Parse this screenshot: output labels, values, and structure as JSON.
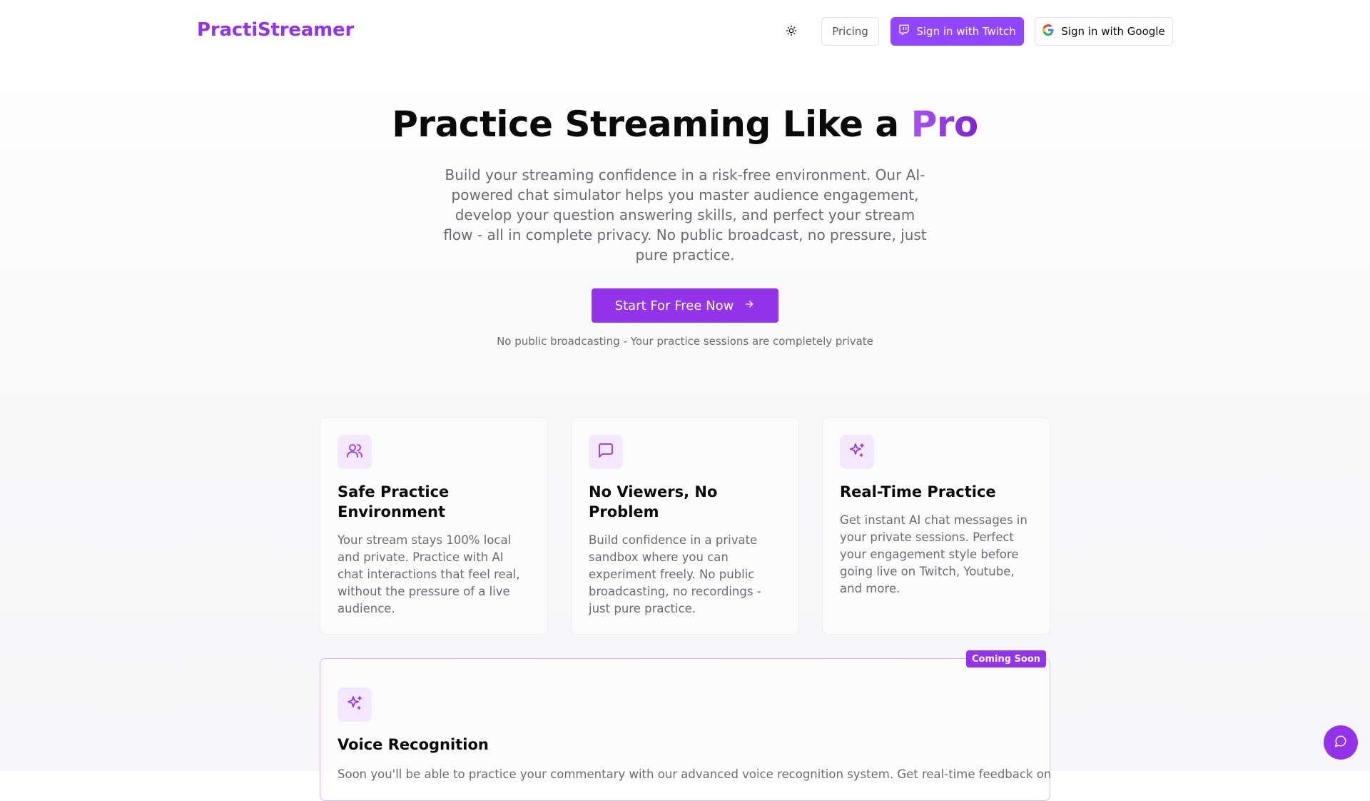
{
  "header": {
    "logo": "PractiStreamer",
    "theme_icon": "sun-icon",
    "pricing_label": "Pricing",
    "twitch_label": "Sign in with Twitch",
    "twitch_icon": "twitch-icon",
    "google_label": "Sign in with Google",
    "google_icon": "google-icon"
  },
  "hero": {
    "title_main": "Practice Streaming Like a ",
    "title_accent": "Pro",
    "description": "Build your streaming confidence in a risk-free environment. Our AI-powered chat simulator helps you master audience engagement, develop your question answering skills, and perfect your stream flow - all in complete privacy. No public broadcast, no pressure, just pure practice.",
    "cta_label": "Start For Free Now",
    "cta_icon": "arrow-right-icon",
    "note": "No public broadcasting - Your practice sessions are completely private"
  },
  "features": [
    {
      "icon": "users-icon",
      "title": "Safe Practice Environment",
      "text": "Your stream stays 100% local and private. Practice with AI chat interactions that feel real, without the pressure of a live audience."
    },
    {
      "icon": "message-square-icon",
      "title": "No Viewers, No Problem",
      "text": "Build confidence in a private sandbox where you can experiment freely. No public broadcasting, no recordings - just pure practice."
    },
    {
      "icon": "sparkles-icon",
      "title": "Real-Time Practice",
      "text": "Get instant AI chat messages in your private sessions. Perfect your engagement style before going live on Twitch, Youtube, and more."
    }
  ],
  "voice": {
    "badge": "Coming Soon",
    "icon": "sparkles-icon",
    "title": "Voice Recognition",
    "text": "Soon you'll be able to practice your commentary with our advanced voice recognition system. Get real-time feedback on"
  },
  "chat_fab": {
    "icon": "chat-bubble-icon"
  },
  "colors": {
    "brand": "#9333ea",
    "twitch": "#9147ff",
    "icon_bg": "#f3e8ff"
  }
}
